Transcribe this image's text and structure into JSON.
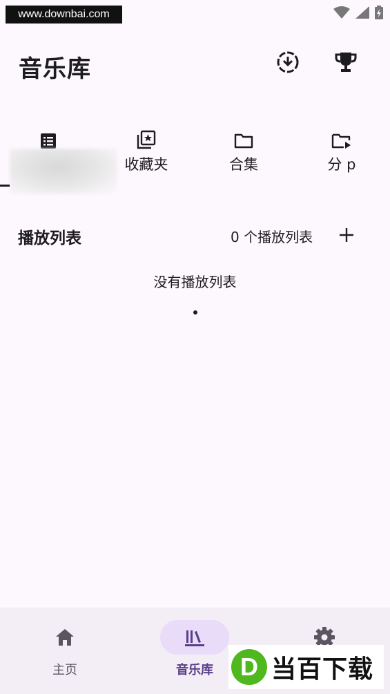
{
  "watermark_top": {
    "text": "www.downbai.com"
  },
  "header": {
    "title": "音乐库"
  },
  "tabs": [
    {
      "label": "",
      "icon": "list-icon",
      "active": true
    },
    {
      "label": "收藏夹",
      "icon": "favorites-icon"
    },
    {
      "label": "合集",
      "icon": "folder-icon"
    },
    {
      "label": "分 p",
      "icon": "folder-play-icon"
    }
  ],
  "playlists": {
    "title": "播放列表",
    "count_text": "0 个播放列表",
    "empty_text": "没有播放列表"
  },
  "bottom_nav": [
    {
      "label": "主页",
      "icon": "home-icon"
    },
    {
      "label": "音乐库",
      "icon": "library-icon",
      "active": true
    },
    {
      "label": "",
      "icon": "gear-icon"
    }
  ],
  "logo_watermark": {
    "mark": "D",
    "text": "当百下载"
  },
  "colors": {
    "background": "#fdf8fd",
    "nav_background": "#f3edf5",
    "active_pill": "#e8dcf9",
    "active_label": "#5a3e8a",
    "logo_green": "#4fb81e"
  }
}
